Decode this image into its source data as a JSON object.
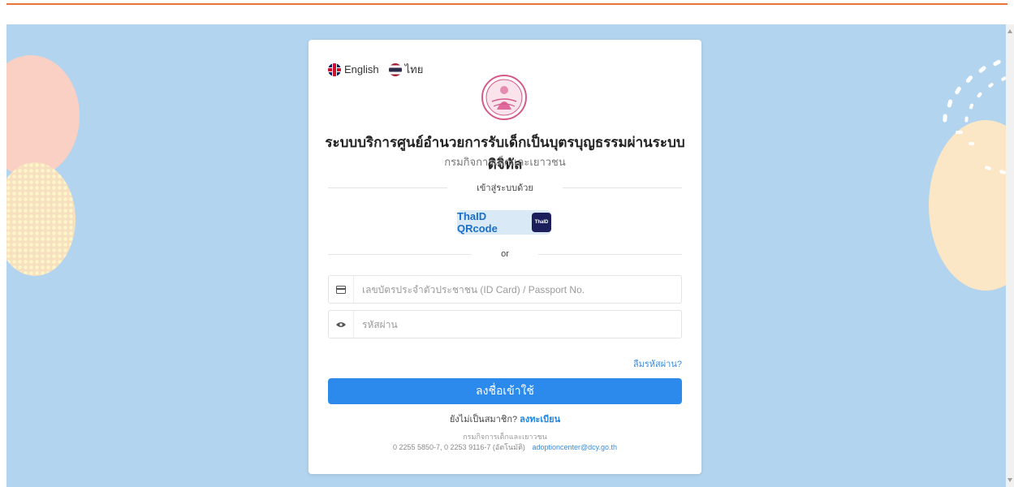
{
  "language": {
    "english_label": "English",
    "thai_label": "ไทย"
  },
  "header": {
    "title": "ระบบบริการศูนย์อำนวยการรับเด็กเป็นบุตรบุญธรรมผ่านระบบดิจิทัล",
    "subtitle": "กรมกิจการเด็กและเยาวชน"
  },
  "login": {
    "login_with_label": "เข้าสู่ระบบด้วย",
    "thaid_button_label": "ThaID QRcode",
    "thaid_logo_text": "ThaID",
    "or_label": "or",
    "id_placeholder": "เลขบัตรประจำตัวประชาชน (ID Card) / Passport No.",
    "password_placeholder": "รหัสผ่าน",
    "forgot_password": "ลืมรหัสผ่าน?",
    "submit_label": "ลงชื่อเข้าใช้",
    "not_member": "ยังไม่เป็นสมาชิก?",
    "register_link": "ลงทะเบียน"
  },
  "footer": {
    "org": "กรมกิจการเด็กและเยาวชน",
    "phones": "0 2255 5850-7, 0 2253 9116-7 (อัตโนมัติ)",
    "email": "adoptioncenter@dcy.go.th"
  },
  "colors": {
    "accent": "#2c8aec",
    "background": "#b3d4ee",
    "top_line": "#e8743b"
  }
}
